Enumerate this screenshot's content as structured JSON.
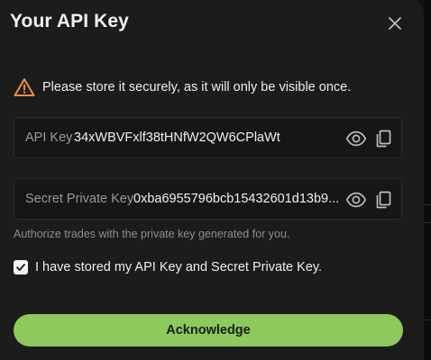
{
  "modal": {
    "title": "Your API Key",
    "close_icon": "close-icon"
  },
  "warning": {
    "icon": "warning-icon",
    "text": "Please store it securely, as it will only be visible once.",
    "color": "#f0903c"
  },
  "api_key": {
    "label": "API Key",
    "value": "34xWBVFxlf38tHNfW2QW6CPlaWt",
    "icons": [
      "eye-icon",
      "copy-icon"
    ]
  },
  "secret_key": {
    "label": "Secret Private Key",
    "value": "0xba6955796bcb15432601d13b9...",
    "icons": [
      "eye-icon",
      "copy-icon"
    ]
  },
  "helper_text": "Authorize trades with the private key generated for you.",
  "confirm": {
    "checked": true,
    "label": "I have stored my API Key and Secret Private Key."
  },
  "acknowledge_button": {
    "label": "Acknowledge",
    "color": "#8dc95b"
  }
}
